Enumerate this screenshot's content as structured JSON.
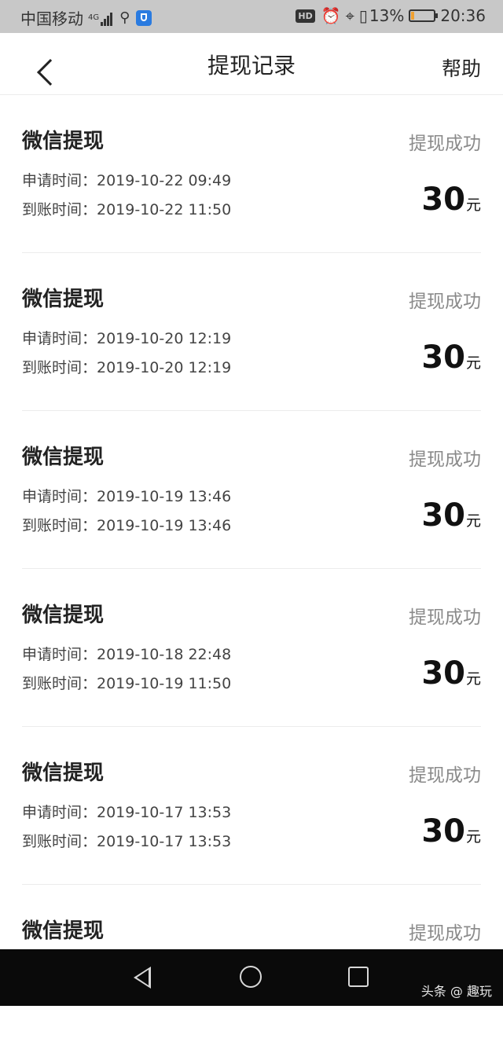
{
  "status_bar": {
    "carrier": "中国移动",
    "network": "4G",
    "battery": "13%",
    "battery_level": 0.13,
    "time": "20:36",
    "hd_label": "HD"
  },
  "header": {
    "title": "提现记录",
    "help": "帮助"
  },
  "records": [
    {
      "title": "微信提现",
      "status": "提现成功",
      "apply": "申请时间：2019-10-22 09:49",
      "arrive": "到账时间：2019-10-22 11:50",
      "amount": "30",
      "unit": "元"
    },
    {
      "title": "微信提现",
      "status": "提现成功",
      "apply": "申请时间：2019-10-20 12:19",
      "arrive": "到账时间：2019-10-20 12:19",
      "amount": "30",
      "unit": "元"
    },
    {
      "title": "微信提现",
      "status": "提现成功",
      "apply": "申请时间：2019-10-19 13:46",
      "arrive": "到账时间：2019-10-19 13:46",
      "amount": "30",
      "unit": "元"
    },
    {
      "title": "微信提现",
      "status": "提现成功",
      "apply": "申请时间：2019-10-18 22:48",
      "arrive": "到账时间：2019-10-19 11:50",
      "amount": "30",
      "unit": "元"
    },
    {
      "title": "微信提现",
      "status": "提现成功",
      "apply": "申请时间：2019-10-17 13:53",
      "arrive": "到账时间：2019-10-17 13:53",
      "amount": "30",
      "unit": "元"
    },
    {
      "title": "微信提现",
      "status": "提现成功"
    }
  ],
  "watermark": "头条 @ 趣玩",
  "icons": {
    "back": "chevron-left-icon",
    "nav_back": "triangle-back-icon",
    "nav_home": "circle-home-icon",
    "nav_recent": "square-recent-icon"
  }
}
